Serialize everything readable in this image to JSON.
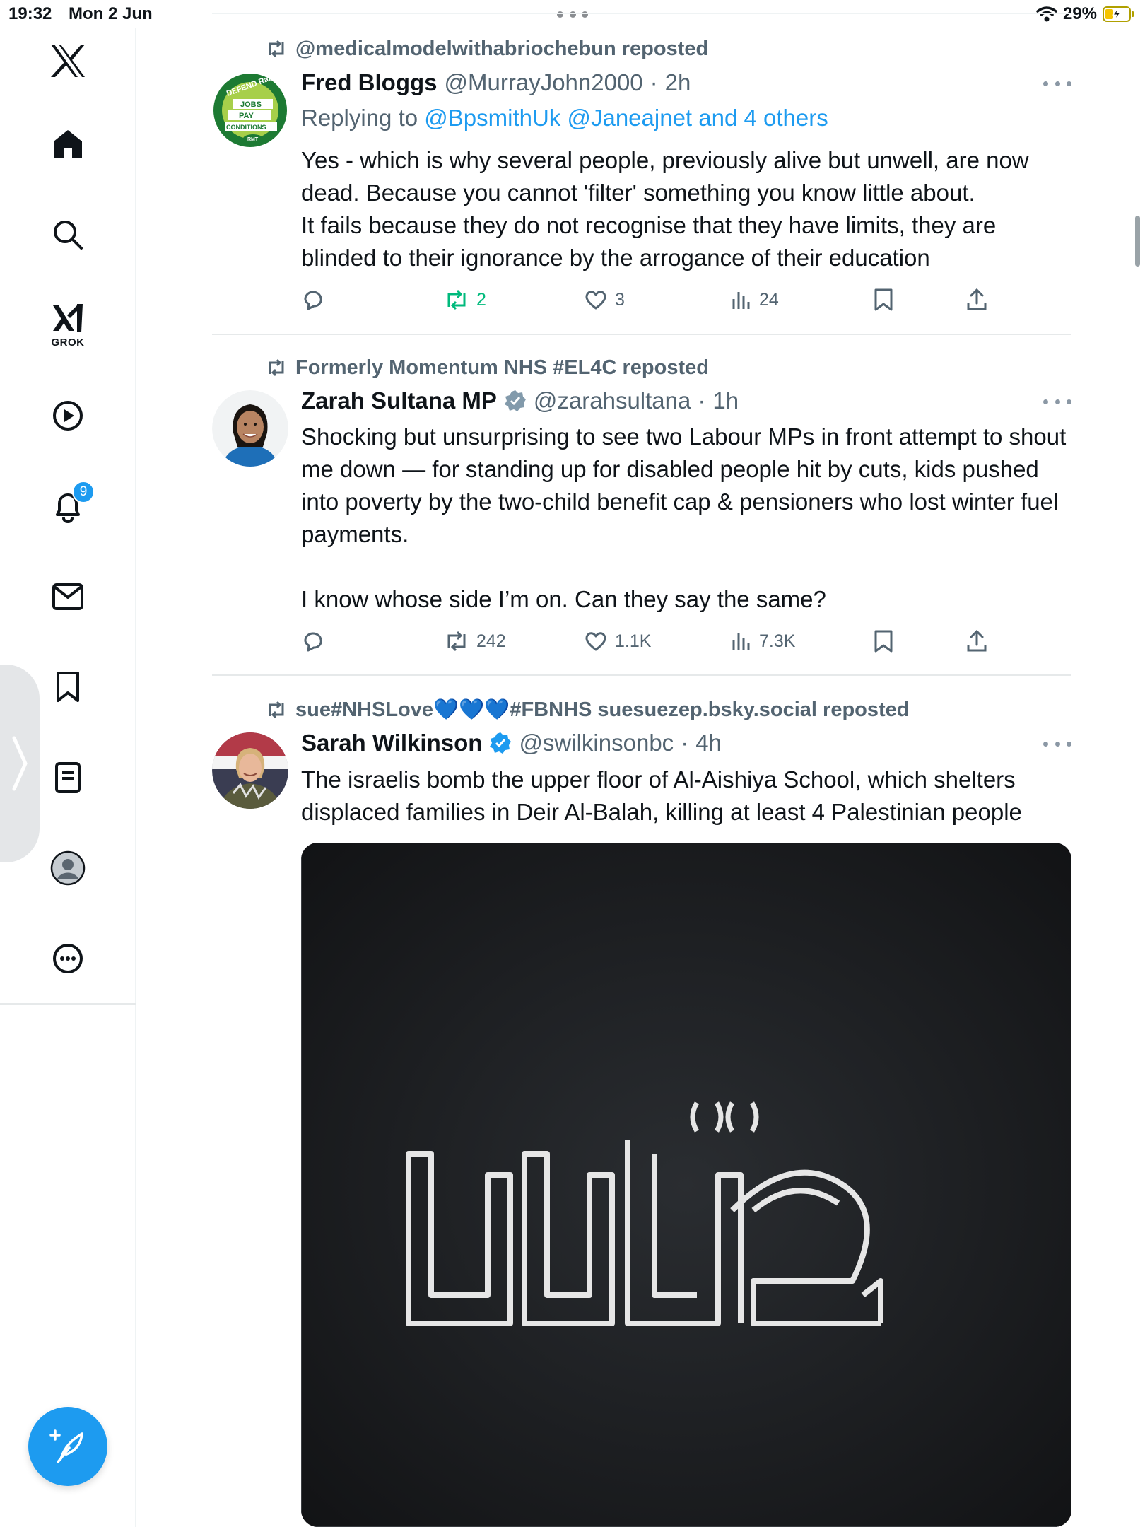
{
  "status_bar": {
    "time": "19:32",
    "date": "Mon 2 Jun",
    "battery": "29%"
  },
  "sidebar": {
    "items": [
      {
        "name": "x-logo"
      },
      {
        "name": "home"
      },
      {
        "name": "search"
      },
      {
        "name": "grok",
        "label": "GROK"
      },
      {
        "name": "video"
      },
      {
        "name": "notifications",
        "badge": "9"
      },
      {
        "name": "messages"
      },
      {
        "name": "bookmarks"
      },
      {
        "name": "lists"
      },
      {
        "name": "profile"
      },
      {
        "name": "more"
      }
    ]
  },
  "feed": {
    "tweets": [
      {
        "reposted_by": "@medicalmodelwithabriochebun reposted",
        "name": "Fred Bloggs",
        "handle": "@MurrayJohn2000",
        "time": "2h",
        "replying_prefix": "Replying to ",
        "replying_to": "@BpsmithUk @Janeajnet and 4 others",
        "text": "Yes - which is why several people, previously alive but unwell, are now dead. Because you cannot 'filter' something you know little about.\nIt fails because they do not recognise that they have limits, they are blinded to their ignorance by the arrogance of their education",
        "replies": "",
        "reposts": "2",
        "likes": "3",
        "views": "24",
        "avatar_text": [
          "DEFEND Rail",
          "JOBS",
          "PAY",
          "CONDITIONS",
          "RMT"
        ]
      },
      {
        "reposted_by": "Formerly Momentum NHS #EL4C reposted",
        "name": "Zarah Sultana MP",
        "handle": "@zarahsultana",
        "time": "1h",
        "text": "Shocking but unsurprising to see two Labour MPs in front attempt to shout me down — for standing up for disabled people hit by cuts, kids pushed into poverty by the two-child benefit cap & pensioners who lost winter fuel payments.\n\nI know whose side I’m on. Can they say the same?",
        "replies": "",
        "reposts": "242",
        "likes": "1.1K",
        "views": "7.3K"
      },
      {
        "reposted_by": "sue#NHSLove💙💙💙#FBNHS suesuezep.bsky.social reposted",
        "name": "Sarah Wilkinson",
        "handle": "@swilkinsonbc",
        "time": "4h",
        "text": "The israelis bomb the upper floor of Al-Aishiya School, which shelters displaced families in Deir Al-Balah, killing at least 4 Palestinian people",
        "media_logo": "قدس"
      }
    ]
  },
  "colors": {
    "accent": "#1d9bf0",
    "muted": "#536471",
    "repost_green": "#00ba7c",
    "text": "#0f1419"
  }
}
